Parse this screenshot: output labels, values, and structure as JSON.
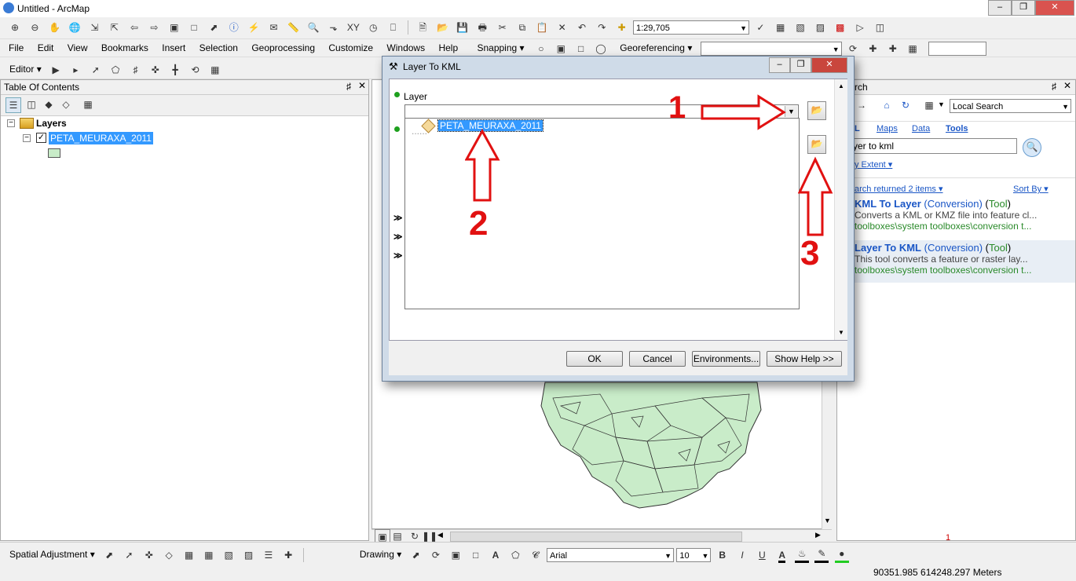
{
  "app": {
    "title": "Untitled - ArcMap"
  },
  "menu": [
    "File",
    "Edit",
    "View",
    "Bookmarks",
    "Insert",
    "Selection",
    "Geoprocessing",
    "Customize",
    "Windows",
    "Help"
  ],
  "toolbar": {
    "scale": "1:29,705",
    "editor": "Editor",
    "snapping": "Snapping",
    "georeferencing": "Georeferencing"
  },
  "toc": {
    "title": "Table Of Contents",
    "root": "Layers",
    "layer": "PETA_MEURAXA_2011",
    "layer_checked": true,
    "swatch_color": "#c8ecc8"
  },
  "dialog": {
    "title": "Layer To KML",
    "field_label": "Layer",
    "layer_value": "",
    "dropdown_item": "PETA_MEURAXA_2011",
    "buttons": {
      "ok": "OK",
      "cancel": "Cancel",
      "env": "Environments...",
      "help": "Show Help >>"
    },
    "annotations": [
      "1",
      "2",
      "3"
    ],
    "annotation_color": "#e11111",
    "tiny_text": "1"
  },
  "search": {
    "title": "rch",
    "scope": "Local Search",
    "tabs": [
      "L",
      "Maps",
      "Data",
      "Tools"
    ],
    "query": "yer to kml",
    "extent": "y Extent",
    "summary": "arch returned 2 items",
    "sort": "Sort By",
    "results": [
      {
        "name": "KML To Layer",
        "type": "(Conversion)",
        "kind": "Tool",
        "desc": "Converts a KML or KMZ file into feature cl...",
        "path": "toolboxes\\system toolboxes\\conversion t..."
      },
      {
        "name": "Layer To KML",
        "type": "(Conversion)",
        "kind": "Tool",
        "desc": "This tool converts a feature or raster lay...",
        "path": "toolboxes\\system toolboxes\\conversion t..."
      }
    ],
    "footer_num": "1"
  },
  "bottom": {
    "spatial_adjustment": "Spatial Adjustment",
    "drawing": "Drawing",
    "font": "Arial",
    "size": "10",
    "coords": "90351.985  614248.297 Meters"
  },
  "map": {
    "fill_color": "#c9ecc9",
    "stroke_color": "#333333"
  }
}
